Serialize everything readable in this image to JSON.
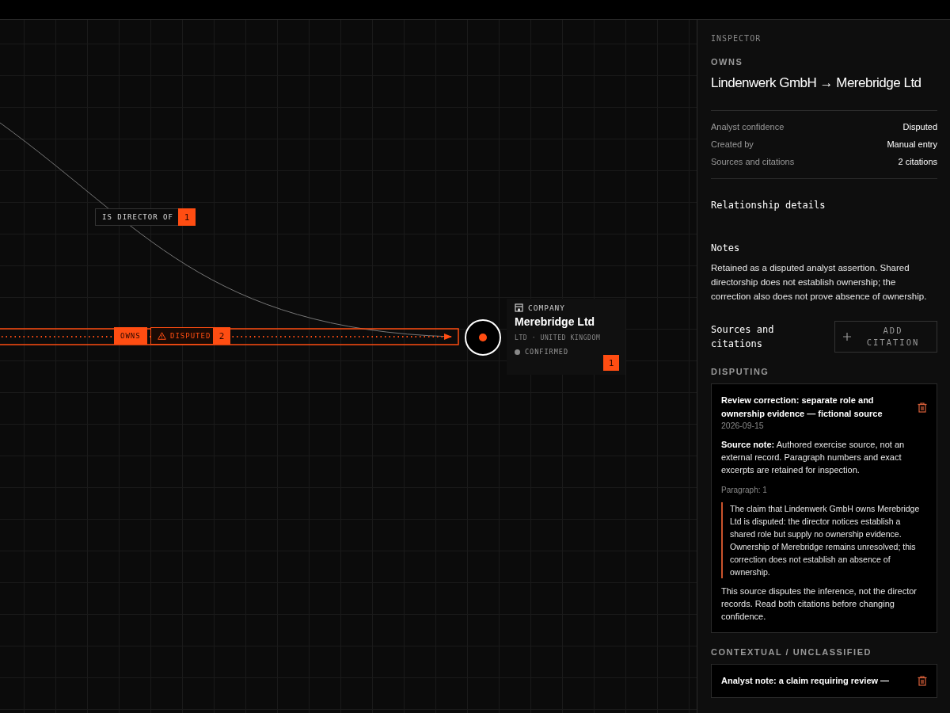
{
  "canvas": {
    "edges": [
      {
        "kind": "curve",
        "label": "IS DIRECTOR OF",
        "count": "1",
        "selected": false
      },
      {
        "kind": "straight",
        "label": "OWNS",
        "status": "DISPUTED",
        "count": "2",
        "selected": true
      }
    ],
    "node": {
      "type": "COMPANY",
      "name": "Merebridge Ltd",
      "subtitle": "LTD · UNITED KINGDOM",
      "status": "CONFIRMED",
      "count": "1"
    }
  },
  "inspector": {
    "section_label": "INSPECTOR",
    "relation": "OWNS",
    "title": "Lindenwerk GmbH → Merebridge Ltd",
    "properties": [
      {
        "label": "Analyst confidence",
        "value": "Disputed"
      },
      {
        "label": "Created by",
        "value": "Manual entry"
      },
      {
        "label": "Sources and citations",
        "value": "2 citations"
      }
    ],
    "details_heading": "Relationship details",
    "notes_heading": "Notes",
    "notes": "Retained as a disputed analyst assertion. Shared directorship does not establish ownership; the correction also does not prove absence of ownership.",
    "sources_heading": "Sources and citations",
    "add_button": "ADD CITATION",
    "groups": [
      {
        "label": "DISPUTING",
        "citations": [
          {
            "title": "Review correction: separate role and ownership evidence — fictional source",
            "date": "2026-09-15",
            "note": "**Source note:** Authored exercise source, not an external record. Paragraph numbers and exact excerpts are retained for inspection.",
            "paragraph": "Paragraph: 1",
            "quote": "The claim that Lindenwerk GmbH owns Merebridge Ltd is disputed: the director notices establish a shared role but supply no ownership evidence. Ownership of Merebridge remains unresolved; this correction does not establish an absence of ownership.",
            "comment": "This source disputes the inference, not the director records. Read both citations before changing confidence."
          }
        ]
      },
      {
        "label": "CONTEXTUAL / UNCLASSIFIED",
        "citations": [
          {
            "title": "Analyst note: a claim requiring review —"
          }
        ]
      }
    ]
  }
}
